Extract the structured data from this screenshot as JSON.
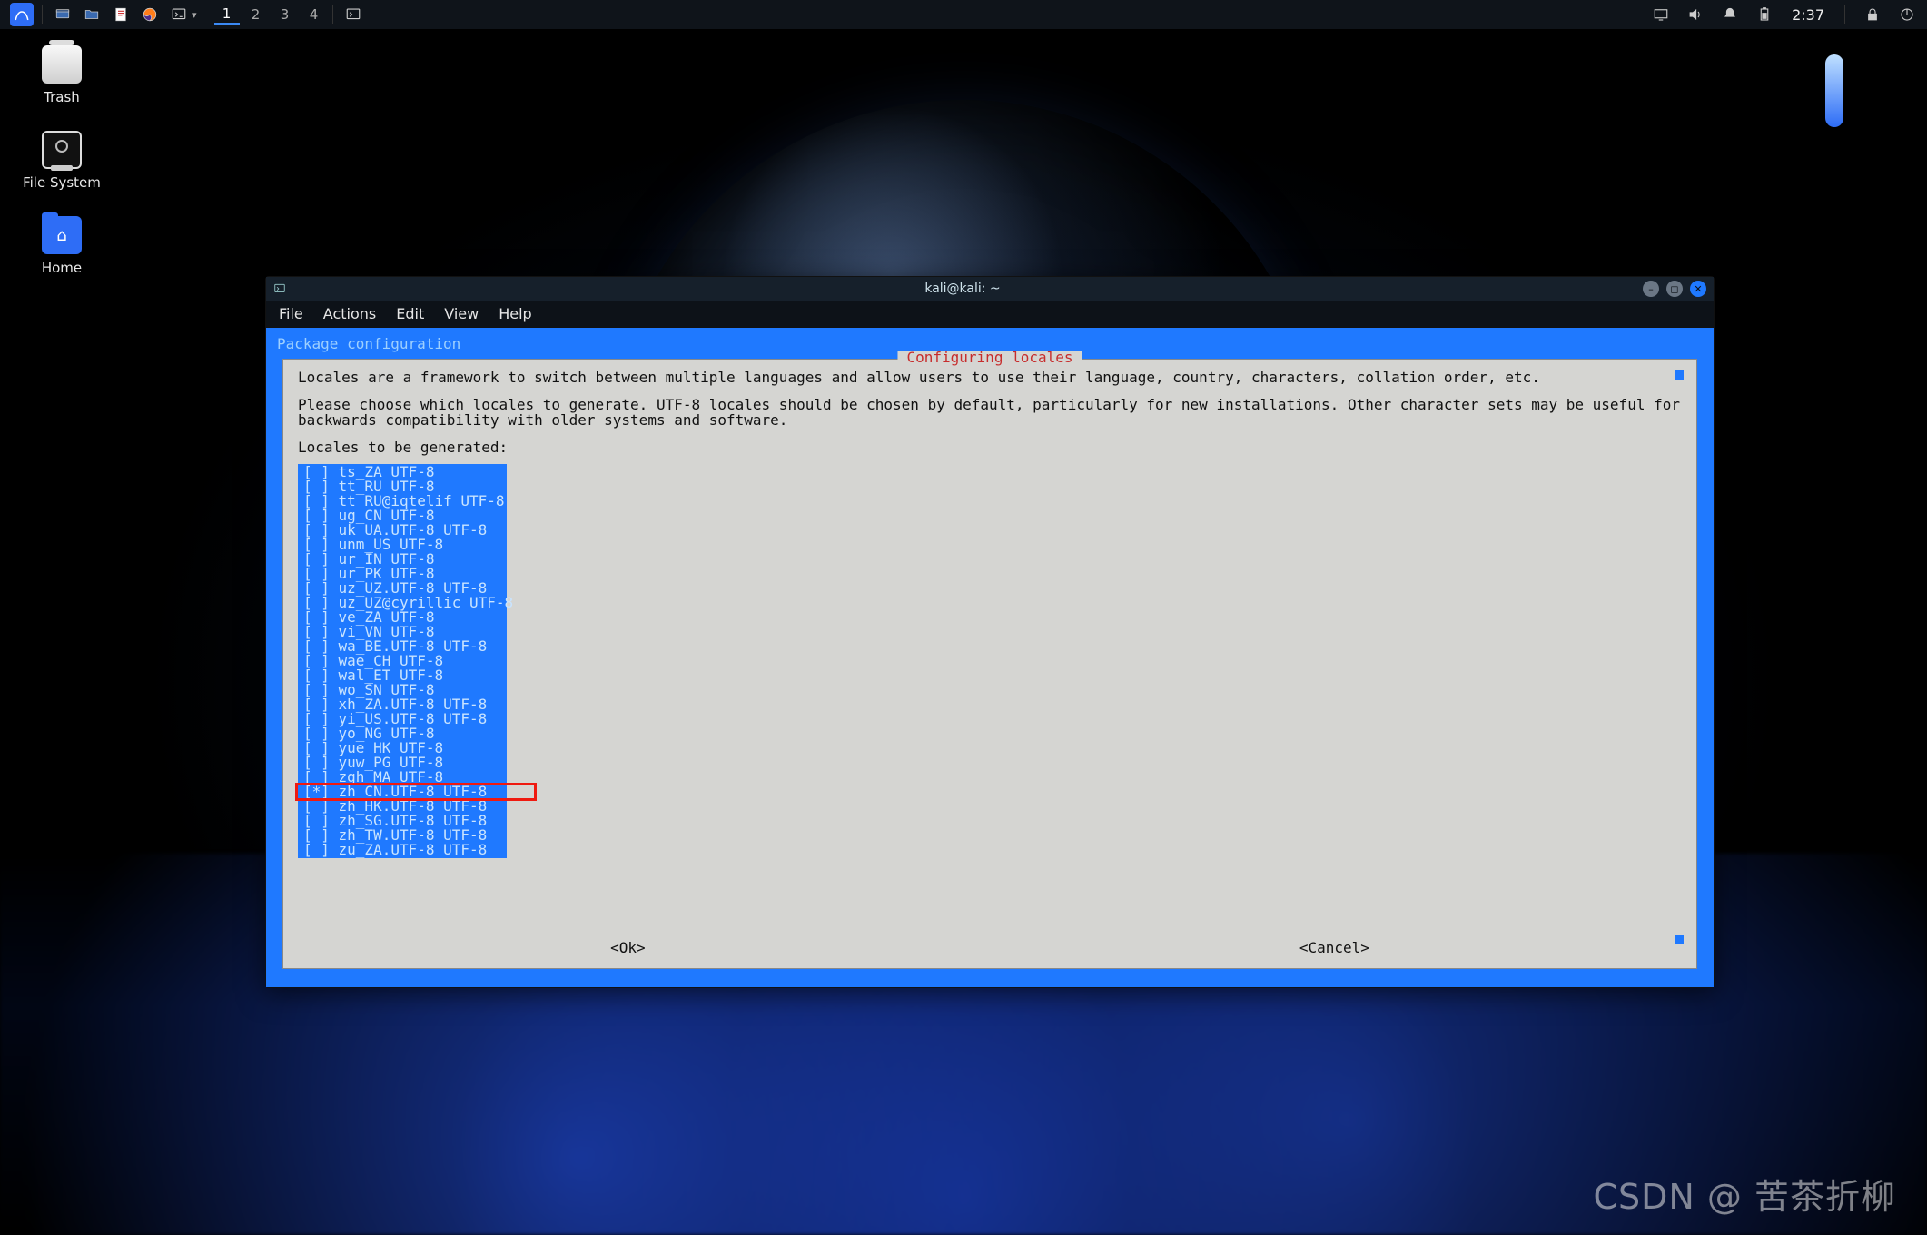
{
  "panel": {
    "workspaces": [
      "1",
      "2",
      "3",
      "4"
    ],
    "current_workspace": 0,
    "clock": "2:37"
  },
  "desktop": {
    "trash_label": "Trash",
    "filesystem_label": "File System",
    "home_label": "Home"
  },
  "window": {
    "title": "kali@kali: ~",
    "menus": {
      "file": "File",
      "actions": "Actions",
      "edit": "Edit",
      "view": "View",
      "help": "Help"
    }
  },
  "dialog": {
    "pkg_line": "Package configuration",
    "title": " Configuring locales ",
    "intro_line1": "Locales are a framework to switch between multiple languages and allow users to use their language, country, characters, collation order, etc.",
    "intro_line2": "Please choose which locales to generate. UTF-8 locales should be chosen by default, particularly for new installations. Other character sets may be useful for backwards compatibility with older systems and software.",
    "prompt": "Locales to be generated:",
    "ok": "<Ok>",
    "cancel": "<Cancel>",
    "locales": [
      {
        "sel": false,
        "label": "ts_ZA UTF-8"
      },
      {
        "sel": false,
        "label": "tt_RU UTF-8"
      },
      {
        "sel": false,
        "label": "tt_RU@iqtelif UTF-8"
      },
      {
        "sel": false,
        "label": "ug_CN UTF-8"
      },
      {
        "sel": false,
        "label": "uk_UA.UTF-8 UTF-8"
      },
      {
        "sel": false,
        "label": "unm_US UTF-8"
      },
      {
        "sel": false,
        "label": "ur_IN UTF-8"
      },
      {
        "sel": false,
        "label": "ur_PK UTF-8"
      },
      {
        "sel": false,
        "label": "uz_UZ.UTF-8 UTF-8"
      },
      {
        "sel": false,
        "label": "uz_UZ@cyrillic UTF-8"
      },
      {
        "sel": false,
        "label": "ve_ZA UTF-8"
      },
      {
        "sel": false,
        "label": "vi_VN UTF-8"
      },
      {
        "sel": false,
        "label": "wa_BE.UTF-8 UTF-8"
      },
      {
        "sel": false,
        "label": "wae_CH UTF-8"
      },
      {
        "sel": false,
        "label": "wal_ET UTF-8"
      },
      {
        "sel": false,
        "label": "wo_SN UTF-8"
      },
      {
        "sel": false,
        "label": "xh_ZA.UTF-8 UTF-8"
      },
      {
        "sel": false,
        "label": "yi_US.UTF-8 UTF-8"
      },
      {
        "sel": false,
        "label": "yo_NG UTF-8"
      },
      {
        "sel": false,
        "label": "yue_HK UTF-8"
      },
      {
        "sel": false,
        "label": "yuw_PG UTF-8"
      },
      {
        "sel": false,
        "label": "zgh_MA UTF-8"
      },
      {
        "sel": true,
        "label": "zh_CN.UTF-8 UTF-8",
        "highlight": true
      },
      {
        "sel": false,
        "label": "zh_HK.UTF-8 UTF-8"
      },
      {
        "sel": false,
        "label": "zh_SG.UTF-8 UTF-8"
      },
      {
        "sel": false,
        "label": "zh_TW.UTF-8 UTF-8"
      },
      {
        "sel": false,
        "label": "zu_ZA.UTF-8 UTF-8"
      }
    ],
    "highlight_index": 22
  },
  "watermark": "CSDN @ 苦茶折柳"
}
